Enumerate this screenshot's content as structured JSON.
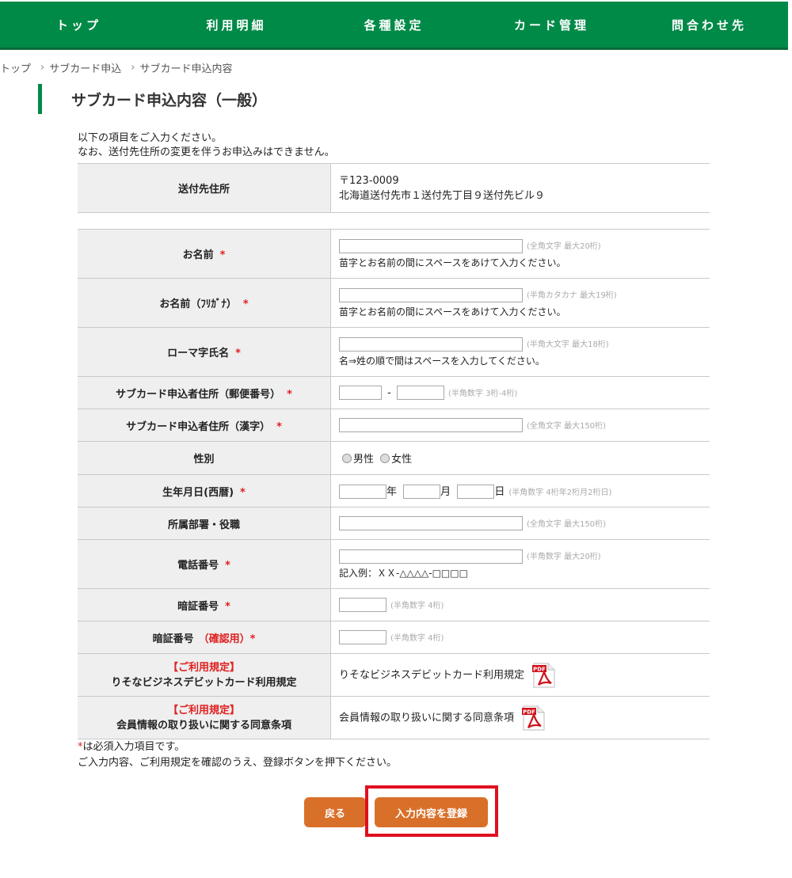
{
  "nav": {
    "items": [
      {
        "label": "トップ"
      },
      {
        "label": "利用明細"
      },
      {
        "label": "各種設定"
      },
      {
        "label": "カード管理"
      },
      {
        "label": "問合わせ先"
      }
    ]
  },
  "breadcrumb": {
    "items": [
      "トップ",
      "サブカード申込",
      "サブカード申込内容"
    ],
    "separator": "›"
  },
  "page_title": "サブカード申込内容（一般）",
  "intro": {
    "line1": "以下の項目をご入力ください。",
    "line2": "なお、送付先住所の変更を伴うお申込みはできません。"
  },
  "address_table": {
    "label": "送付先住所",
    "postal": "〒123-0009",
    "address": "北海道送付先市１送付先丁目９送付先ビル９"
  },
  "required_mark": "*",
  "form": {
    "name": {
      "label": "お名前",
      "note": "(全角文字 最大20桁)",
      "hint": "苗字とお名前の間にスペースをあけて入力ください。"
    },
    "name_kana": {
      "label": "お名前（ﾌﾘｶﾞﾅ）",
      "note": "(半角カタカナ 最大19桁)",
      "hint": "苗字とお名前の間にスペースをあけて入力ください。"
    },
    "name_roman": {
      "label": "ローマ字氏名",
      "note": "(半角大文字 最大18桁)",
      "hint": "名⇒姓の順で間はスペースを入力してください。"
    },
    "postal": {
      "label": "サブカード申込者住所（郵便番号）",
      "dash": "-",
      "note": "(半角数字 3桁-4桁)"
    },
    "address_kanji": {
      "label": "サブカード申込者住所（漢字）",
      "note": "(全角文字 最大150桁)"
    },
    "gender": {
      "label": "性別",
      "male": "男性",
      "female": "女性"
    },
    "birthdate": {
      "label": "生年月日(西暦)",
      "year": "年",
      "month": "月",
      "day": "日",
      "note": "(半角数字 4桁年2桁月2桁日)"
    },
    "department": {
      "label": "所属部署・役職",
      "note": "(全角文字 最大150桁)"
    },
    "phone": {
      "label": "電話番号",
      "note": "(半角数字 最大20桁)",
      "hint": "記入例：ＸＸ-△△△△-□□□□"
    },
    "pin": {
      "label": "暗証番号",
      "note": "(半角数字 4桁)"
    },
    "pin_confirm": {
      "label": "暗証番号",
      "label_red": "（確認用）",
      "note": "(半角数字 4桁)"
    },
    "terms1": {
      "label_red": "【ご利用規定】",
      "label": "りそなビジネスデビットカード利用規定",
      "link": "りそなビジネスデビットカード利用規定"
    },
    "terms2": {
      "label_red": "【ご利用規定】",
      "label": "会員情報の取り扱いに関する同意条項",
      "link": "会員情報の取り扱いに関する同意条項"
    }
  },
  "pdf_icon_text": "PDF",
  "footnote": {
    "line1": "は必須入力項目です。",
    "line2": "ご入力内容、ご利用規定を確認のうえ、登録ボタンを押下ください。"
  },
  "buttons": {
    "back": "戻る",
    "register": "入力内容を登録"
  },
  "colors": {
    "nav_green": "#008a47",
    "required_red": "#e02020",
    "button_orange": "#d9702a",
    "highlight_red": "#e0101f"
  }
}
